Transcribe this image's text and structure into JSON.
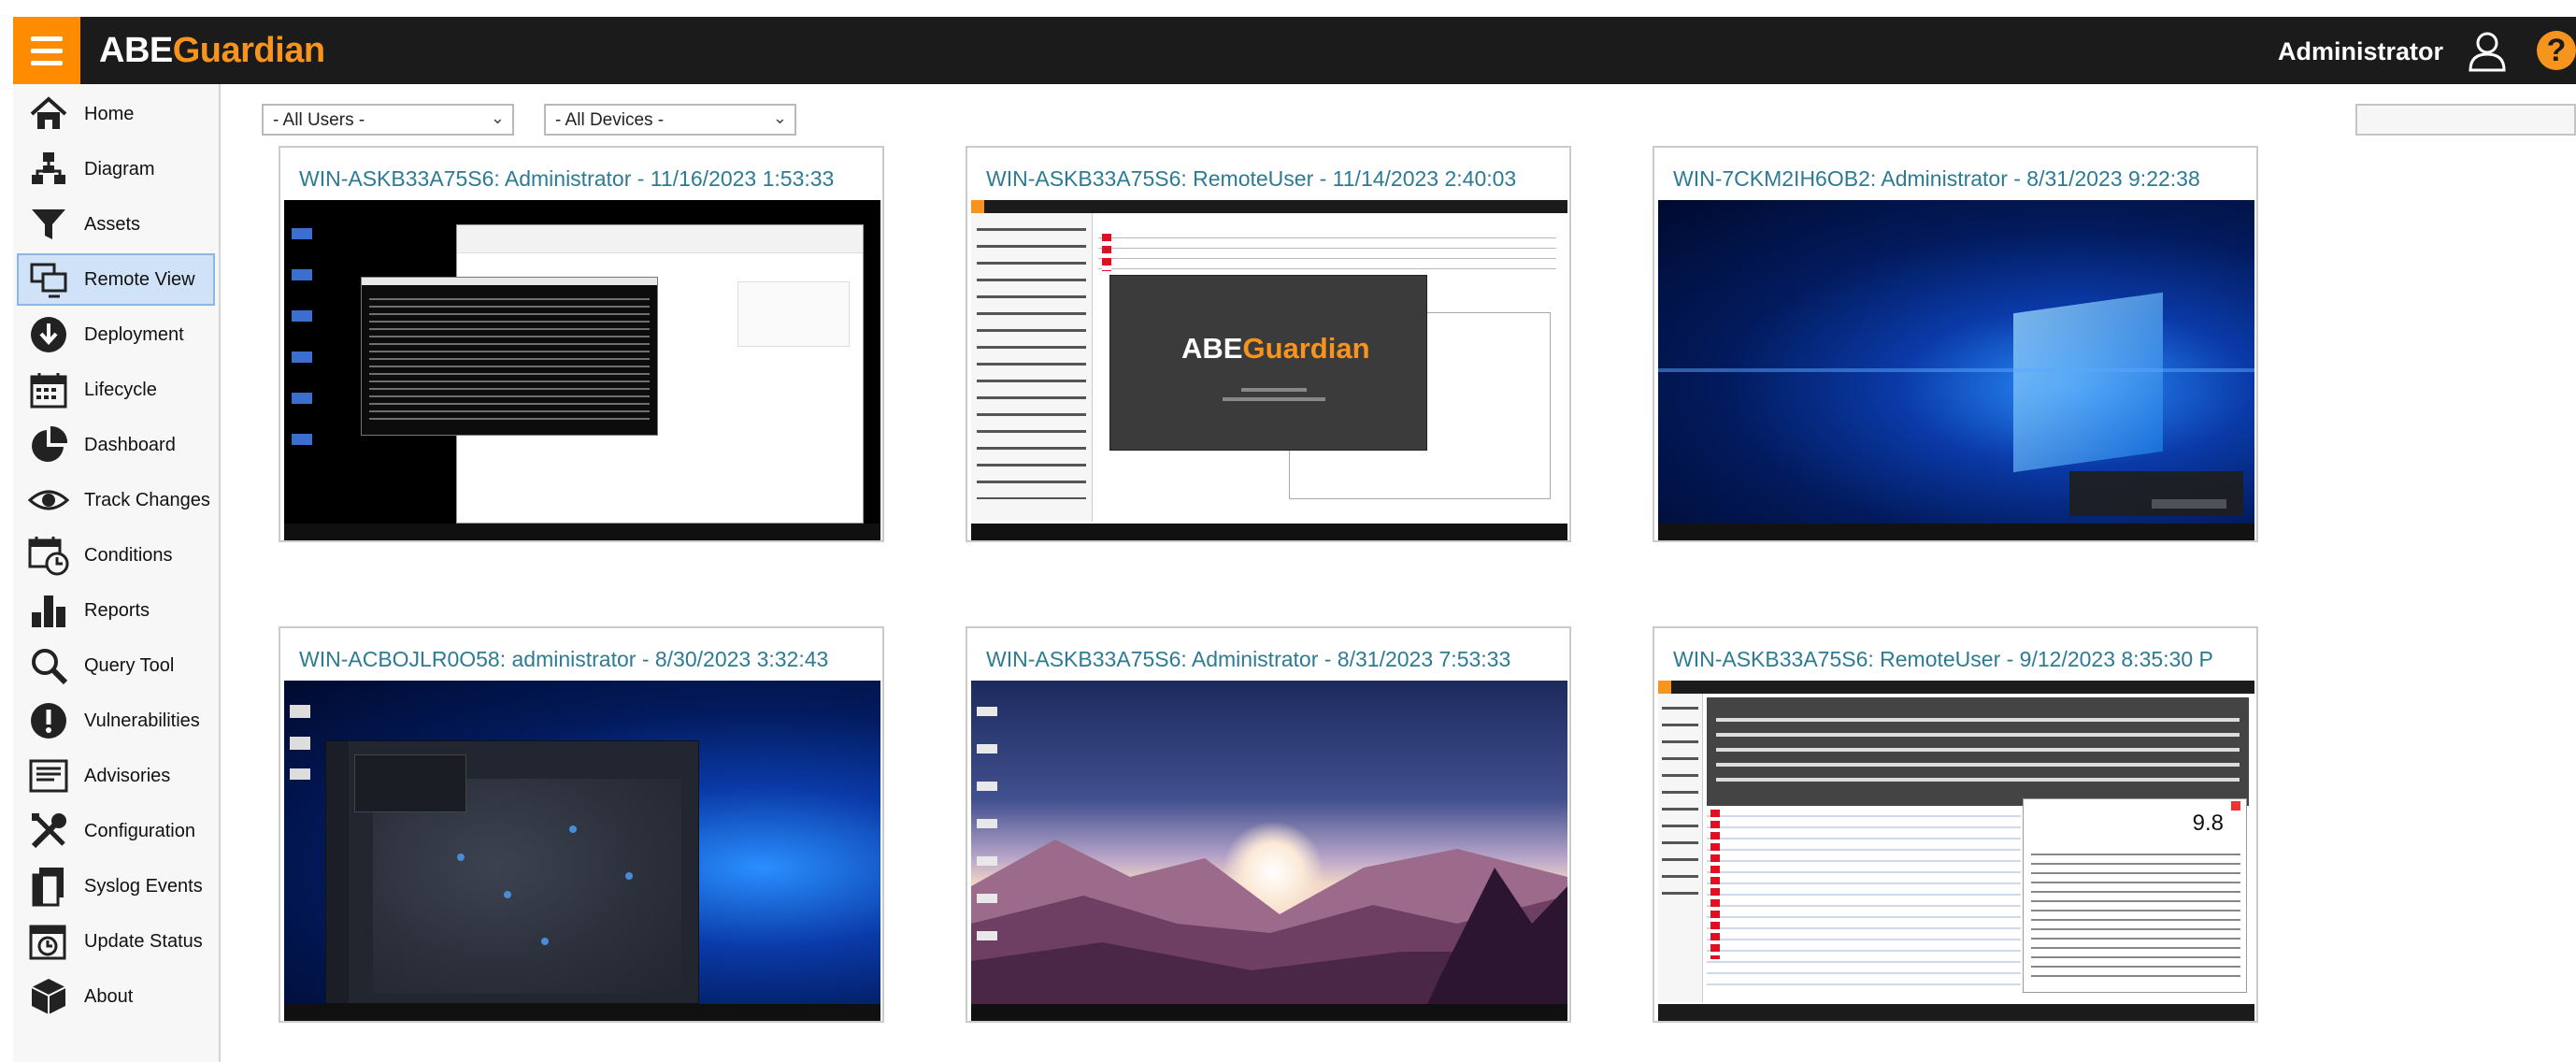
{
  "header": {
    "logo_abe": "ABE",
    "logo_guardian": "Guardian",
    "user": "Administrator",
    "help": "?"
  },
  "sidebar": {
    "items": [
      {
        "label": "Home",
        "icon": "home-icon"
      },
      {
        "label": "Diagram",
        "icon": "diagram-icon"
      },
      {
        "label": "Assets",
        "icon": "funnel-icon"
      },
      {
        "label": "Remote View",
        "icon": "remote-view-icon",
        "active": true
      },
      {
        "label": "Deployment",
        "icon": "download-icon"
      },
      {
        "label": "Lifecycle",
        "icon": "calendar-icon"
      },
      {
        "label": "Dashboard",
        "icon": "pie-icon"
      },
      {
        "label": "Track Changes",
        "icon": "eye-icon"
      },
      {
        "label": "Conditions",
        "icon": "calendar-clock-icon"
      },
      {
        "label": "Reports",
        "icon": "bar-chart-icon"
      },
      {
        "label": "Query Tool",
        "icon": "magnifier-icon"
      },
      {
        "label": "Vulnerabilities",
        "icon": "alert-icon"
      },
      {
        "label": "Advisories",
        "icon": "advisory-icon"
      },
      {
        "label": "Configuration",
        "icon": "tools-icon"
      },
      {
        "label": "Syslog Events",
        "icon": "document-icon"
      },
      {
        "label": "Update Status",
        "icon": "update-icon"
      },
      {
        "label": "About",
        "icon": "box-icon"
      }
    ]
  },
  "filters": {
    "users": "- All Users -",
    "devices": "- All Devices -"
  },
  "sessions": [
    {
      "title": "WIN-ASKB33A75S6: Administrator  -  11/16/2023 1:53:33",
      "kind": "explorer"
    },
    {
      "title": "WIN-ASKB33A75S6: RemoteUser  -  11/14/2023 2:40:03",
      "kind": "abe-splash"
    },
    {
      "title": "WIN-7CKM2IH6OB2: Administrator  -  8/31/2023 9:22:38",
      "kind": "win10-blue"
    },
    {
      "title": "WIN-ACBOJLR0O58: administrator  -  8/30/2023 3:32:43",
      "kind": "world-map"
    },
    {
      "title": "WIN-ASKB33A75S6: Administrator  -  8/31/2023 7:53:33",
      "kind": "landscape"
    },
    {
      "title": "WIN-ASKB33A75S6: RemoteUser  -  9/12/2023 8:35:30 P",
      "kind": "abe-vuln"
    }
  ],
  "thumb_text": {
    "splash_abe": "ABE",
    "splash_guardian": "Guardian",
    "vuln_score": "9.8"
  },
  "colors": {
    "accent": "#f7941d",
    "topbar": "#1b1b1b",
    "title_link": "#2d7b92",
    "active_nav": "#cfe2f7"
  }
}
